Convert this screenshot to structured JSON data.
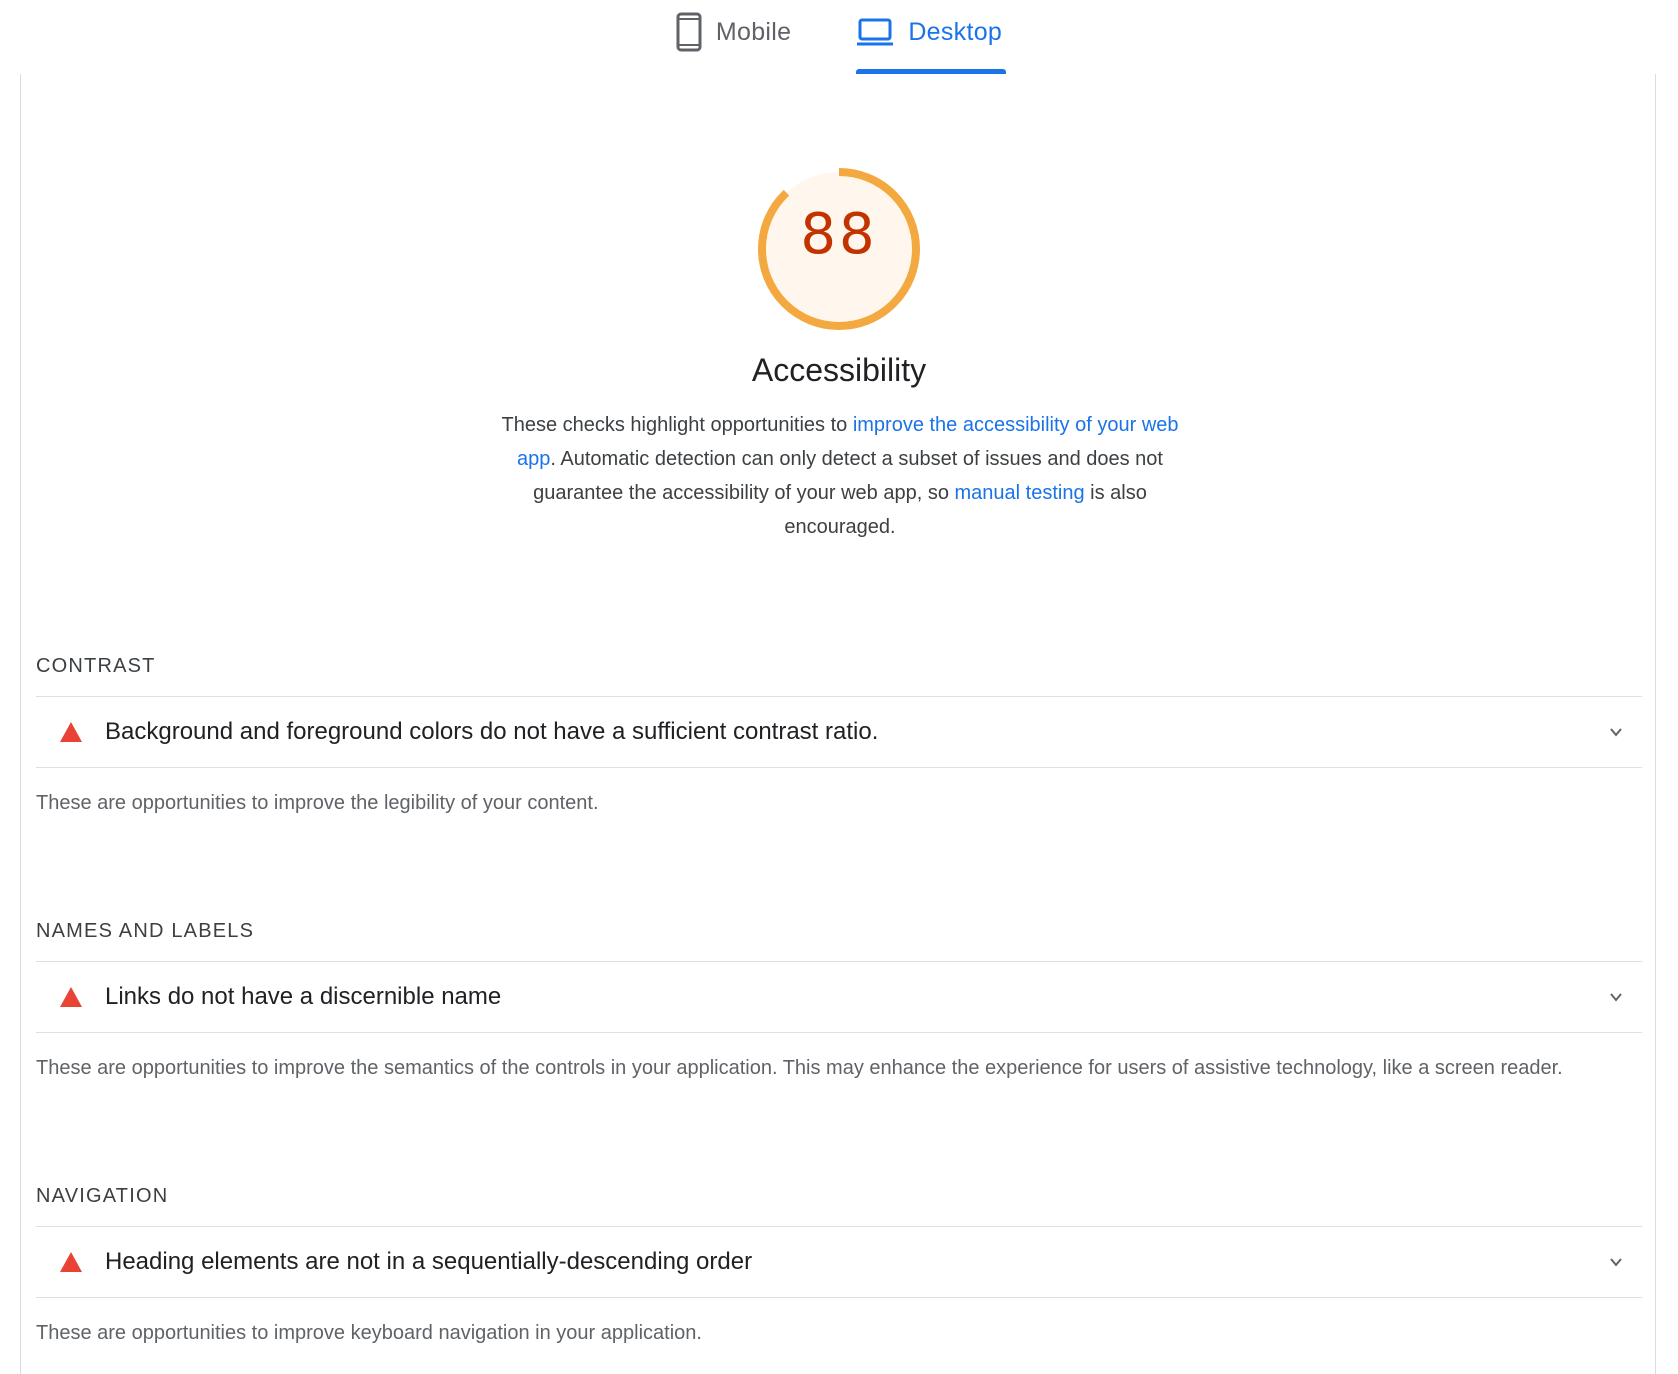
{
  "tabs": {
    "mobile": {
      "label": "Mobile",
      "icon": "smartphone-icon"
    },
    "desktop": {
      "label": "Desktop",
      "icon": "laptop-icon",
      "selected": true
    }
  },
  "colors": {
    "accent": "#1a73e8",
    "gauge_average": "#f4a840",
    "gauge_fill": "#fff7ee",
    "score_text": "#c33300",
    "fail": "#e94335"
  },
  "score": {
    "value": "88",
    "fraction": 0.88,
    "title": "Accessibility"
  },
  "description": {
    "part1": "These checks highlight opportunities to ",
    "link1": "improve the accessibility of your web app",
    "part2": ". Automatic detection can only detect a subset of issues and does not guarantee the accessibility of your web app, so ",
    "link2": "manual testing",
    "part3": " is also encouraged."
  },
  "groups": [
    {
      "heading": "CONTRAST",
      "audit_title": "Background and foreground colors do not have a sufficient contrast ratio.",
      "description": "These are opportunities to improve the legibility of your content."
    },
    {
      "heading": "NAMES AND LABELS",
      "audit_title": "Links do not have a discernible name",
      "description": "These are opportunities to improve the semantics of the controls in your application. This may enhance the experience for users of assistive technology, like a screen reader."
    },
    {
      "heading": "NAVIGATION",
      "audit_title": "Heading elements are not in a sequentially-descending order",
      "description": "These are opportunities to improve keyboard navigation in your application."
    }
  ]
}
